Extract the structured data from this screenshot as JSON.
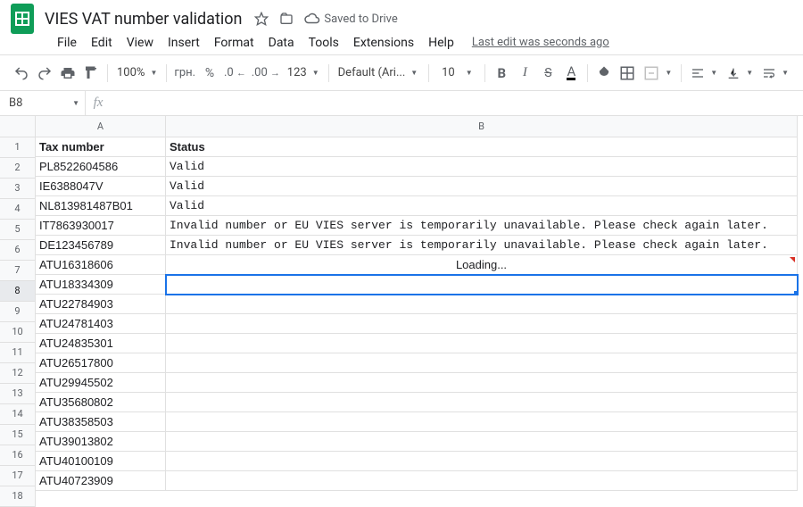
{
  "doc": {
    "title": "VIES VAT number validation",
    "save_status": "Saved to Drive"
  },
  "menus": {
    "file": "File",
    "edit": "Edit",
    "view": "View",
    "insert": "Insert",
    "format": "Format",
    "data": "Data",
    "tools": "Tools",
    "extensions": "Extensions",
    "help": "Help",
    "last_edit": "Last edit was seconds ago"
  },
  "toolbar": {
    "zoom": "100%",
    "currency": "грн.",
    "percent": "%",
    "num_fmt": "123",
    "font": "Default (Ari...",
    "font_size": "10"
  },
  "namebox": {
    "ref": "B8"
  },
  "columns": {
    "A": "A",
    "B": "B"
  },
  "headers": {
    "A": "Tax number",
    "B": "Status"
  },
  "rows": [
    {
      "n": "1",
      "a": "Tax number",
      "b": "Status",
      "bold": true
    },
    {
      "n": "2",
      "a": "PL8522604586",
      "b": "Valid",
      "mono": true
    },
    {
      "n": "3",
      "a": "IE6388047V",
      "b": "Valid",
      "mono": true
    },
    {
      "n": "4",
      "a": "NL813981487B01",
      "b": "Valid",
      "mono": true
    },
    {
      "n": "5",
      "a": "IT7863930017",
      "b": "Invalid number or EU VIES server is temporarily unavailable. Please check again later.",
      "mono": true
    },
    {
      "n": "6",
      "a": "DE123456789",
      "b": "Invalid number or EU VIES server is temporarily unavailable. Please check again later.",
      "mono": true
    },
    {
      "n": "7",
      "a": "ATU16318606",
      "b": "Loading...",
      "center": true,
      "overflow": true
    },
    {
      "n": "8",
      "a": "ATU18334309",
      "b": "",
      "selected": true
    },
    {
      "n": "9",
      "a": "ATU22784903",
      "b": ""
    },
    {
      "n": "10",
      "a": "ATU24781403",
      "b": ""
    },
    {
      "n": "11",
      "a": "ATU24835301",
      "b": ""
    },
    {
      "n": "12",
      "a": "ATU26517800",
      "b": ""
    },
    {
      "n": "13",
      "a": "ATU29945502",
      "b": ""
    },
    {
      "n": "14",
      "a": "ATU35680802",
      "b": ""
    },
    {
      "n": "15",
      "a": "ATU38358503",
      "b": ""
    },
    {
      "n": "16",
      "a": "ATU39013802",
      "b": ""
    },
    {
      "n": "17",
      "a": "ATU40100109",
      "b": ""
    },
    {
      "n": "18",
      "a": "ATU40723909",
      "b": ""
    }
  ]
}
